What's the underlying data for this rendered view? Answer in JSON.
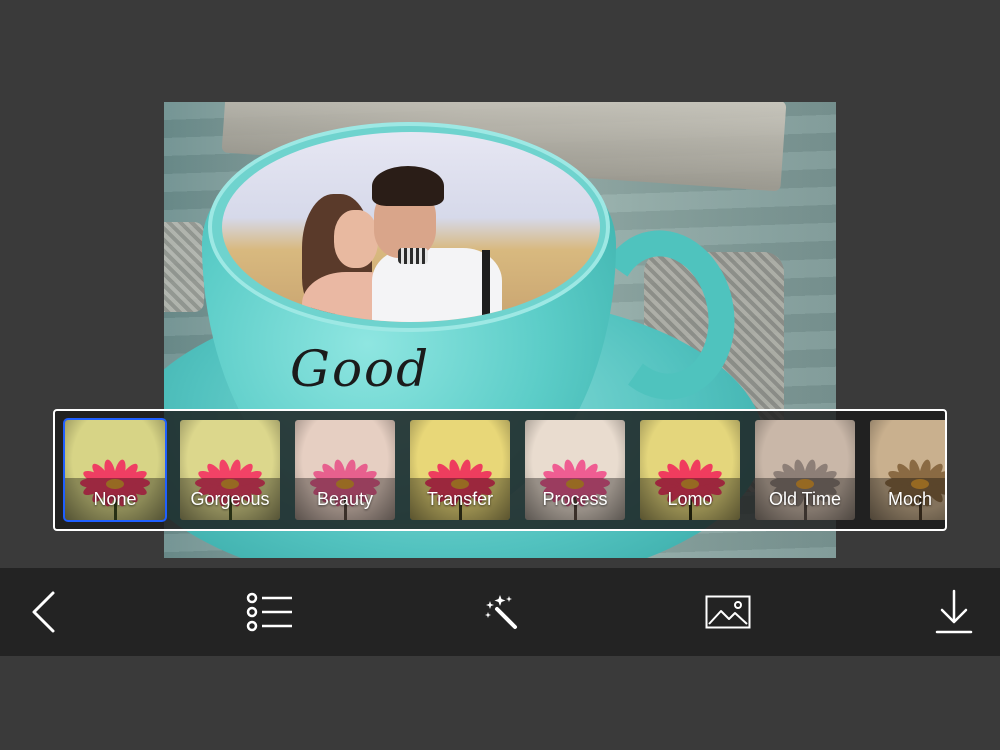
{
  "photo_text": "Good",
  "filters": [
    {
      "label": "None",
      "selected": true,
      "tint": "#d7d486",
      "petal": "#ef3e63",
      "stem": "#3c4a20"
    },
    {
      "label": "Gorgeous",
      "selected": false,
      "tint": "#dcd78c",
      "petal": "#f24266",
      "stem": "#3c4a20"
    },
    {
      "label": "Beauty",
      "selected": false,
      "tint": "#e6cfc2",
      "petal": "#e7608e",
      "stem": "#5a4a40"
    },
    {
      "label": "Transfer",
      "selected": false,
      "tint": "#e8d778",
      "petal": "#ee3d5e",
      "stem": "#3a3a1c"
    },
    {
      "label": "Process",
      "selected": false,
      "tint": "#e9dccf",
      "petal": "#ef5d92",
      "stem": "#5a4a40"
    },
    {
      "label": "Lomo",
      "selected": false,
      "tint": "#e4d67c",
      "petal": "#f03c5e",
      "stem": "#2d2d10"
    },
    {
      "label": "Old Time",
      "selected": false,
      "tint": "#c9b7a8",
      "petal": "#8d7f77",
      "stem": "#5a4e46"
    },
    {
      "label": "Moch",
      "selected": false,
      "tint": "#c9b08e",
      "petal": "#8a6a43",
      "stem": "#4a3a26"
    }
  ],
  "toolbar": {
    "icons": [
      "back-icon",
      "list-icon",
      "magic-wand-icon",
      "image-icon",
      "download-icon"
    ]
  },
  "colors": {
    "background": "#3a3a3a",
    "toolbar": "#232323",
    "selection": "#1f5fff",
    "icon": "#ffffff"
  }
}
